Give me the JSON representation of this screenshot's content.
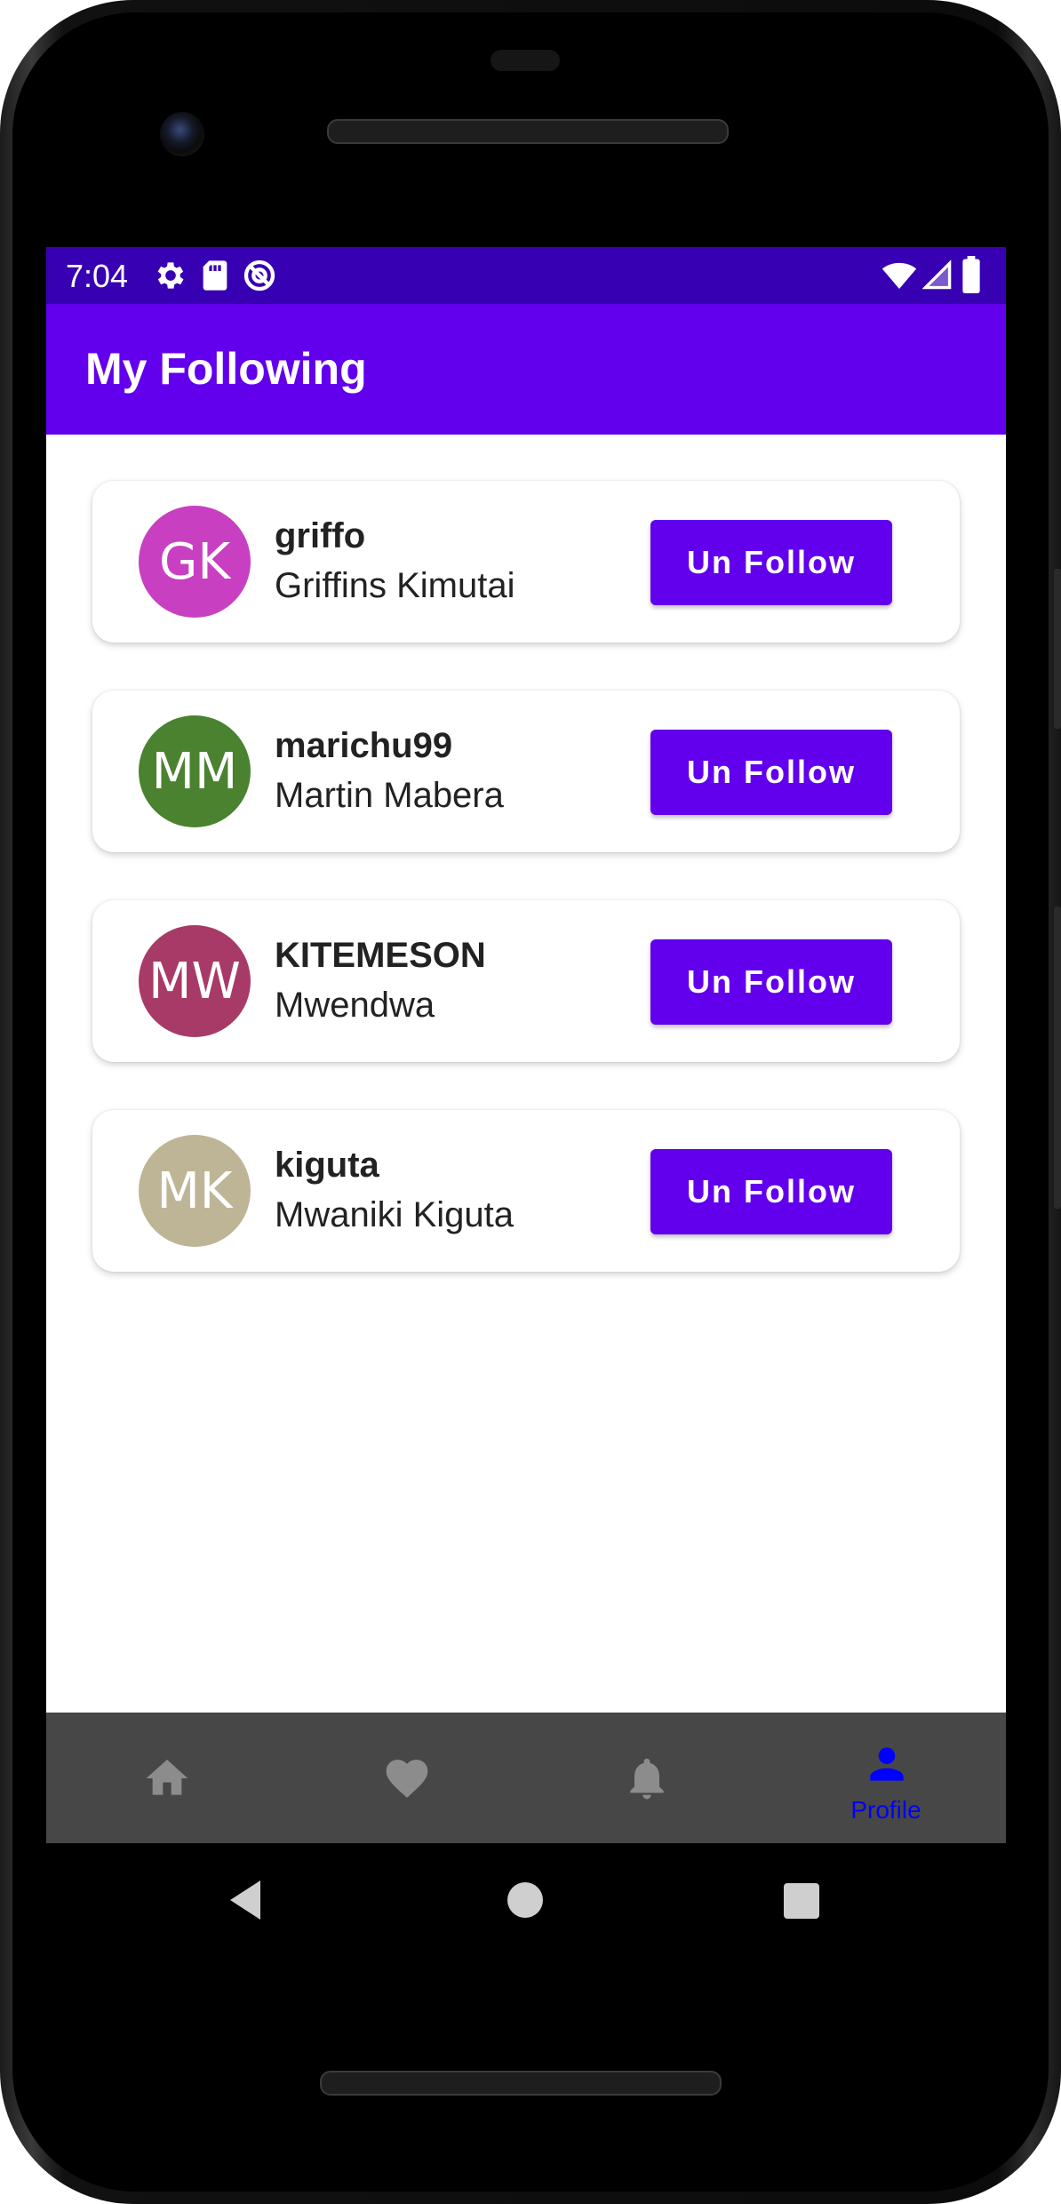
{
  "status_bar": {
    "time": "7:04",
    "left_icons": [
      "gear-icon",
      "sd-card-icon",
      "sync-icon"
    ],
    "right_icons": [
      "wifi-icon",
      "signal-icon",
      "battery-icon"
    ],
    "color": "#3700B3"
  },
  "app_bar": {
    "title": "My Following",
    "color": "#6200EE"
  },
  "following": [
    {
      "initials": "GK",
      "username": "griffo",
      "name": "Griffins Kimutai",
      "avatar_color": "#C83FC1",
      "button_label": "Un Follow"
    },
    {
      "initials": "MM",
      "username": "marichu99",
      "name": "Martin Mabera",
      "avatar_color": "#4A8230",
      "button_label": "Un Follow"
    },
    {
      "initials": "MW",
      "username": "KITEMESON",
      "name": "Mwendwa",
      "avatar_color": "#A83A67",
      "button_label": "Un Follow"
    },
    {
      "initials": "MK",
      "username": "kiguta",
      "name": "Mwaniki Kiguta",
      "avatar_color": "#BDB596",
      "button_label": "Un Follow"
    }
  ],
  "bottom_nav": {
    "items": [
      {
        "icon": "home-icon",
        "label": "",
        "active": false
      },
      {
        "icon": "heart-icon",
        "label": "",
        "active": false
      },
      {
        "icon": "bell-icon",
        "label": "",
        "active": false
      },
      {
        "icon": "person-icon",
        "label": "Profile",
        "active": true
      }
    ],
    "background": "#474747",
    "active_color": "#0000FF",
    "inactive_color": "#8C8C8C"
  },
  "system_nav": {
    "icons": [
      "back-icon",
      "home-circle-icon",
      "recents-icon"
    ]
  }
}
